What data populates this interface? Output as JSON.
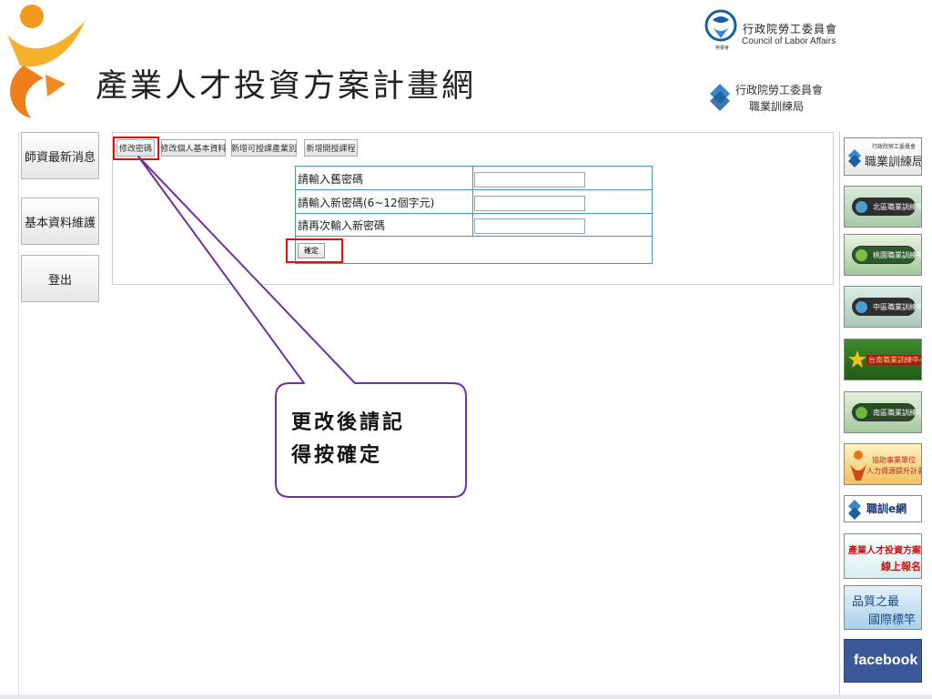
{
  "header": {
    "site_title": "產業人才投資方案計畫網",
    "cla_name_zh": "行政院勞工委員會",
    "cla_name_en": "Council of Labor Affairs",
    "bvt_line1": "行政院勞工委員會",
    "bvt_line2": "職業訓練局"
  },
  "left_nav": {
    "items": [
      {
        "label": "師資最新消息"
      },
      {
        "label": "基本資料維護"
      },
      {
        "label": "登出"
      }
    ]
  },
  "tabs": [
    {
      "label": "修改密碼"
    },
    {
      "label": "修改個人基本資料"
    },
    {
      "label": "新增可授課產業別"
    },
    {
      "label": "新增開授課程"
    }
  ],
  "password_form": {
    "old_password_label": "請輸入舊密碼",
    "new_password_label": "請輸入新密碼(6~12個字元)",
    "confirm_password_label": "請再次輸入新密碼",
    "old_password_value": "",
    "new_password_value": "",
    "confirm_password_value": "",
    "confirm_button": "確定"
  },
  "callout": {
    "line1": "更改後請記",
    "line2": "得按確定"
  },
  "right_sidebar": {
    "banner1_line1": "行政院勞工委員會",
    "banner1_line2": "職業訓練局",
    "banner2_label": "北區職業訓練中心",
    "banner3_label": "桃園職業訓練中心",
    "banner4_label": "中區職業訓練中心",
    "banner5_label": "台南職業訓練中心",
    "banner6_label": "南區職業訓練中心",
    "banner7_line1": "協助事業單位",
    "banner7_line2": "人力資源提升計畫",
    "banner8_label": "職訓e網",
    "banner9_line1": "產業人才投資方案",
    "banner9_line2": "線上報名",
    "banner10_line1": "品質之最",
    "banner10_line2": "國際標竿",
    "banner11_label": "facebook"
  },
  "colors": {
    "accent_red": "#e01010",
    "callout_purple": "#7030a0",
    "table_border": "#4a90c0",
    "logo_orange": "#f39a1e"
  }
}
